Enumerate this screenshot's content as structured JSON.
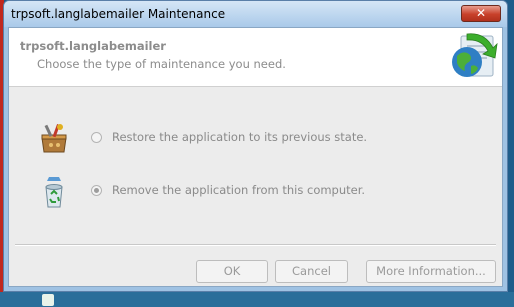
{
  "window": {
    "title": "trpsoft.langlabemailer Maintenance",
    "close_glyph": "✕"
  },
  "header": {
    "title": "trpsoft.langlabemailer",
    "subtitle": "Choose the type of maintenance you need.",
    "icon": "setup-globe-icon"
  },
  "options": [
    {
      "label": "Restore the application to its previous state.",
      "selected": false,
      "icon": "toolbox-icon"
    },
    {
      "label": "Remove the application from this computer.",
      "selected": true,
      "icon": "recycle-bin-icon"
    }
  ],
  "buttons": {
    "ok": "OK",
    "cancel": "Cancel",
    "more_info": "More Information..."
  },
  "colors": {
    "titlebar": "#a9c9e9",
    "close_button": "#c8412b",
    "dialog_background": "#ececec",
    "disabled_text": "#8c8c8c"
  }
}
